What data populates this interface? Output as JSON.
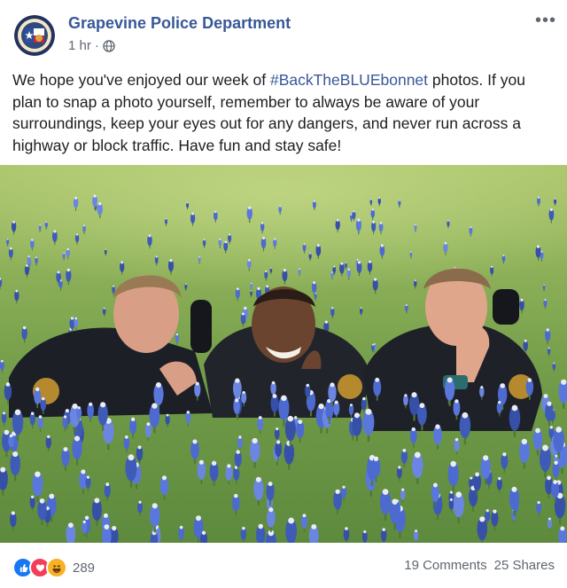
{
  "post": {
    "page_name": "Grapevine Police Department",
    "time": "1 hr",
    "separator": "·",
    "privacy_icon": "globe-icon",
    "more_icon": "ellipsis-icon",
    "more_label": "•••",
    "text_before": "We hope you've enjoyed our week of ",
    "hashtag": "#BackTheBLUEbonnet",
    "text_after": " photos. If you plan to snap a photo yourself, remember to always be aware of your surroundings, keep your eyes out for any dangers, and never run across a highway or block traffic. Have fun and stay safe!"
  },
  "footer": {
    "reaction_icons": [
      "like-icon",
      "love-icon",
      "haha-icon"
    ],
    "reaction_count": "289",
    "comments": "19 Comments",
    "shares": "25 Shares"
  },
  "colors": {
    "link": "#385898",
    "like": "#1877f2",
    "love": "#f33e58",
    "haha": "#f7b125",
    "meta": "#606770"
  }
}
